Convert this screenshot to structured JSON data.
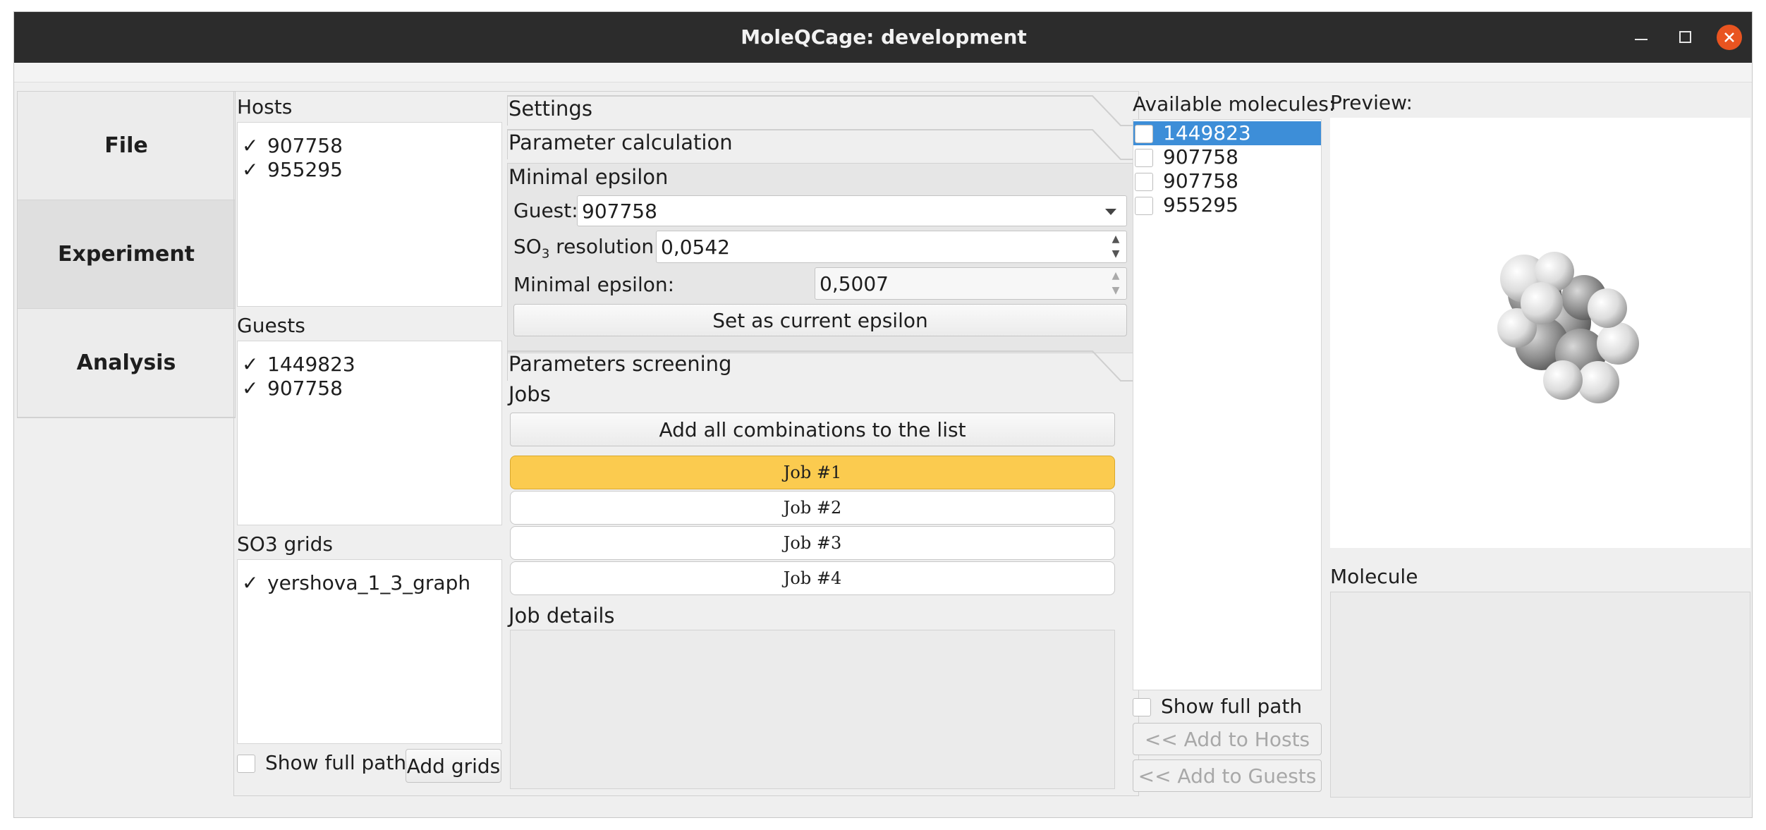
{
  "window": {
    "title": "MoleQCage: development"
  },
  "nav": {
    "items": [
      {
        "label": "File"
      },
      {
        "label": "Experiment"
      },
      {
        "label": "Analysis"
      }
    ]
  },
  "hosts": {
    "label": "Hosts",
    "items": [
      "907758",
      "955295"
    ]
  },
  "guests": {
    "label": "Guests",
    "items": [
      "1449823",
      "907758"
    ]
  },
  "grids": {
    "label": "SO3 grids",
    "items": [
      "yershova_1_3_graph"
    ],
    "show_full_path": "Show full path",
    "add_grids": "Add grids"
  },
  "check_mark": "✓",
  "settings": {
    "tab_settings": "Settings",
    "tab_param_calc": "Parameter calculation",
    "minimal_epsilon_header": "Minimal epsilon",
    "guest_label": "Guest:",
    "guest_value": "907758",
    "so3_label_prefix": "SO",
    "so3_label_sub": "3",
    "so3_label_suffix": " resolution:",
    "so3_value": "0,0542",
    "min_eps_label": "Minimal epsilon:",
    "min_eps_value": "0,5007",
    "set_eps_button": "Set as current epsilon",
    "tab_screening": "Parameters screening"
  },
  "jobs": {
    "header": "Jobs",
    "add_all": "Add all combinations to the list",
    "items": [
      "Job  #1",
      "Job  #2",
      "Job  #3",
      "Job  #4"
    ],
    "selected_index": 0,
    "details_label": "Job details"
  },
  "available": {
    "label": "Available molecules:",
    "items": [
      "1449823",
      "907758",
      "907758",
      "955295"
    ],
    "selected_index": 0,
    "show_full_path": "Show full path",
    "add_hosts": "<< Add to Hosts",
    "add_guests": "<< Add to Guests"
  },
  "preview": {
    "label": "Preview:",
    "molecule_label": "Molecule"
  },
  "colors": {
    "selected_job": "#fbcb4f",
    "selected_list": "#3d8ed8",
    "titlebar": "#2c2c2c",
    "close": "#e95420"
  }
}
